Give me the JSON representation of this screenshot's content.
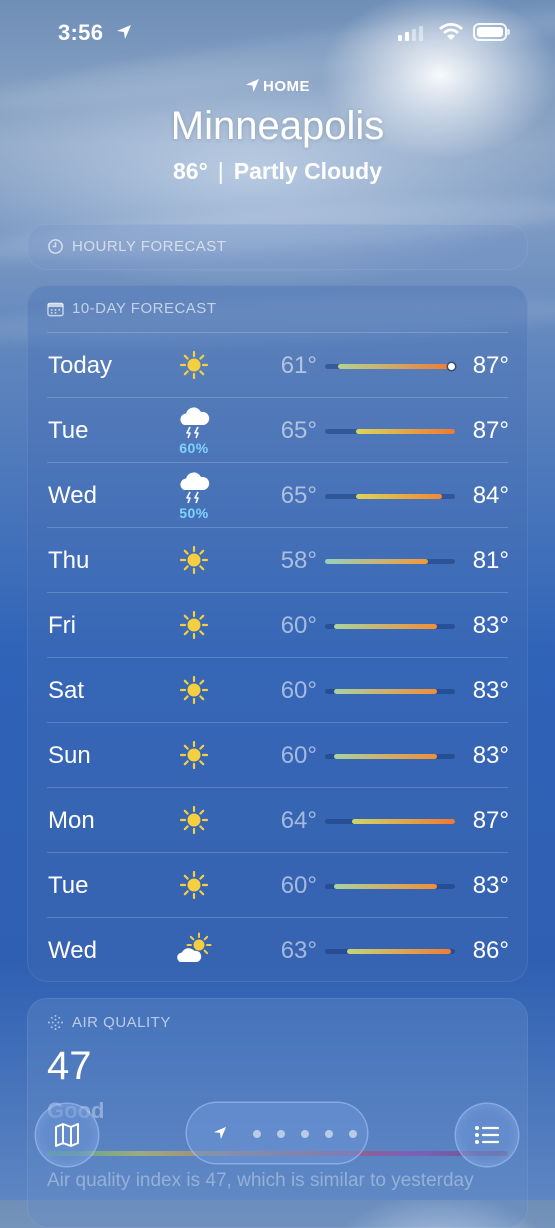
{
  "status_bar": {
    "time": "3:56"
  },
  "header": {
    "home_label": "HOME",
    "city": "Minneapolis",
    "temperature": "86°",
    "separator": "|",
    "condition": "Partly Cloudy"
  },
  "hourly": {
    "title": "HOURLY FORECAST",
    "icon": "clock-icon"
  },
  "ten_day": {
    "title": "10-DAY FORECAST",
    "icon": "calendar-icon",
    "range_min": 58,
    "range_max": 87,
    "days": [
      {
        "day": "Today",
        "icon": "sun-icon",
        "precip": "",
        "low": "61°",
        "high": "87°",
        "low_val": 61,
        "high_val": 87,
        "current": 86
      },
      {
        "day": "Tue",
        "icon": "thunderstorm-icon",
        "precip": "60%",
        "low": "65°",
        "high": "87°",
        "low_val": 65,
        "high_val": 87
      },
      {
        "day": "Wed",
        "icon": "thunderstorm-icon",
        "precip": "50%",
        "low": "65°",
        "high": "84°",
        "low_val": 65,
        "high_val": 84
      },
      {
        "day": "Thu",
        "icon": "sun-icon",
        "precip": "",
        "low": "58°",
        "high": "81°",
        "low_val": 58,
        "high_val": 81
      },
      {
        "day": "Fri",
        "icon": "sun-icon",
        "precip": "",
        "low": "60°",
        "high": "83°",
        "low_val": 60,
        "high_val": 83
      },
      {
        "day": "Sat",
        "icon": "sun-icon",
        "precip": "",
        "low": "60°",
        "high": "83°",
        "low_val": 60,
        "high_val": 83
      },
      {
        "day": "Sun",
        "icon": "sun-icon",
        "precip": "",
        "low": "60°",
        "high": "83°",
        "low_val": 60,
        "high_val": 83
      },
      {
        "day": "Mon",
        "icon": "sun-icon",
        "precip": "",
        "low": "64°",
        "high": "87°",
        "low_val": 64,
        "high_val": 87
      },
      {
        "day": "Tue",
        "icon": "sun-icon",
        "precip": "",
        "low": "60°",
        "high": "83°",
        "low_val": 60,
        "high_val": 83
      },
      {
        "day": "Wed",
        "icon": "partly-cloudy-icon",
        "precip": "",
        "low": "63°",
        "high": "86°",
        "low_val": 63,
        "high_val": 86
      }
    ]
  },
  "air_quality": {
    "title": "AIR QUALITY",
    "icon": "air-quality-icon",
    "value": "47",
    "category": "Good",
    "description": "Air quality index is 47, which is similar to yesterday"
  },
  "toolbar": {
    "map_icon": "map-icon",
    "list_icon": "list-icon",
    "location_icon": "location-arrow-icon",
    "page_dots": 5
  }
}
